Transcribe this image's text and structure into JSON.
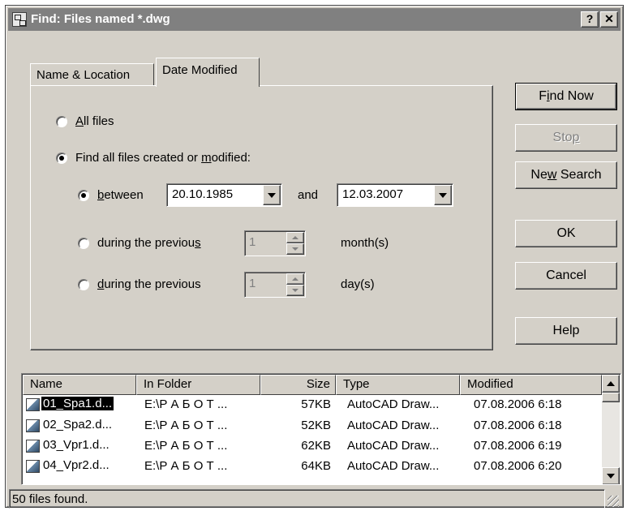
{
  "window": {
    "title": "Find: Files named *.dwg",
    "help_label": "?",
    "close_label": "✕"
  },
  "tabs": [
    {
      "label": "Name & Location",
      "active": false
    },
    {
      "label": "Date Modified",
      "active": true
    }
  ],
  "date_panel": {
    "all_files": {
      "pre": "",
      "key": "A",
      "post": "ll files",
      "selected": false
    },
    "find_all": {
      "pre": "Find all files created or ",
      "key": "m",
      "post": "odified:",
      "selected": true
    },
    "between": {
      "pre": "",
      "key": "b",
      "post": "etween",
      "selected": true
    },
    "from_date": "20.10.1985",
    "and_label": "and",
    "to_date": "12.03.2007",
    "prev_months": {
      "pre": "during the previou",
      "key": "s",
      "post": "",
      "selected": false,
      "value": "1",
      "unit": "month(s)"
    },
    "prev_days": {
      "pre": "",
      "key": "d",
      "post": "uring the previous",
      "selected": false,
      "value": "1",
      "unit": "day(s)"
    }
  },
  "buttons": {
    "find_now": {
      "pre": "F",
      "key": "i",
      "post": "nd Now"
    },
    "stop": {
      "pre": "Sto",
      "key": "p",
      "post": ""
    },
    "new_search": {
      "pre": "Ne",
      "key": "w",
      "post": " Search"
    },
    "ok": "OK",
    "cancel": "Cancel",
    "help": "Help"
  },
  "results": {
    "columns": [
      "Name",
      "In Folder",
      "Size",
      "Type",
      "Modified"
    ],
    "rows": [
      {
        "name": "01_Spa1.d...",
        "folder": "E:\\Р А Б О Т ...",
        "size": "57KB",
        "type": "AutoCAD Draw...",
        "modified": "07.08.2006 6:18",
        "selected": true
      },
      {
        "name": "02_Spa2.d...",
        "folder": "E:\\Р А Б О Т ...",
        "size": "52KB",
        "type": "AutoCAD Draw...",
        "modified": "07.08.2006 6:18",
        "selected": false
      },
      {
        "name": "03_Vpr1.d...",
        "folder": "E:\\Р А Б О Т ...",
        "size": "62KB",
        "type": "AutoCAD Draw...",
        "modified": "07.08.2006 6:19",
        "selected": false
      },
      {
        "name": "04_Vpr2.d...",
        "folder": "E:\\Р А Б О Т ...",
        "size": "64KB",
        "type": "AutoCAD Draw...",
        "modified": "07.08.2006 6:20",
        "selected": false
      }
    ]
  },
  "status": {
    "text": "50 files found."
  }
}
